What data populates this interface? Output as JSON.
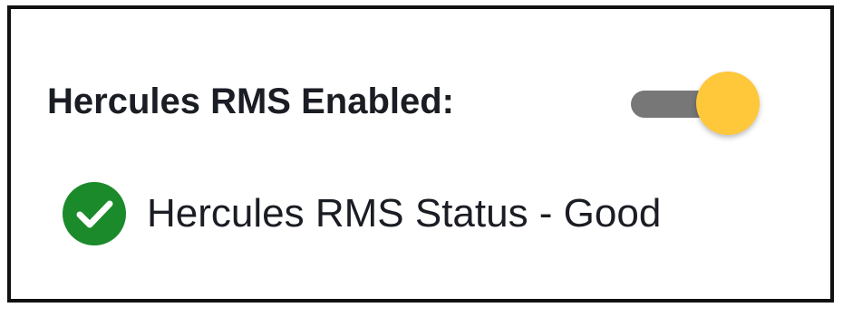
{
  "settings": {
    "enabled_label": "Hercules RMS Enabled:",
    "toggle": {
      "state": "on",
      "knob_color": "#FFC83A",
      "track_color": "#777777"
    }
  },
  "status": {
    "icon": "check-circle-icon",
    "icon_color": "#1A8A2A",
    "text": "Hercules RMS Status - Good"
  }
}
